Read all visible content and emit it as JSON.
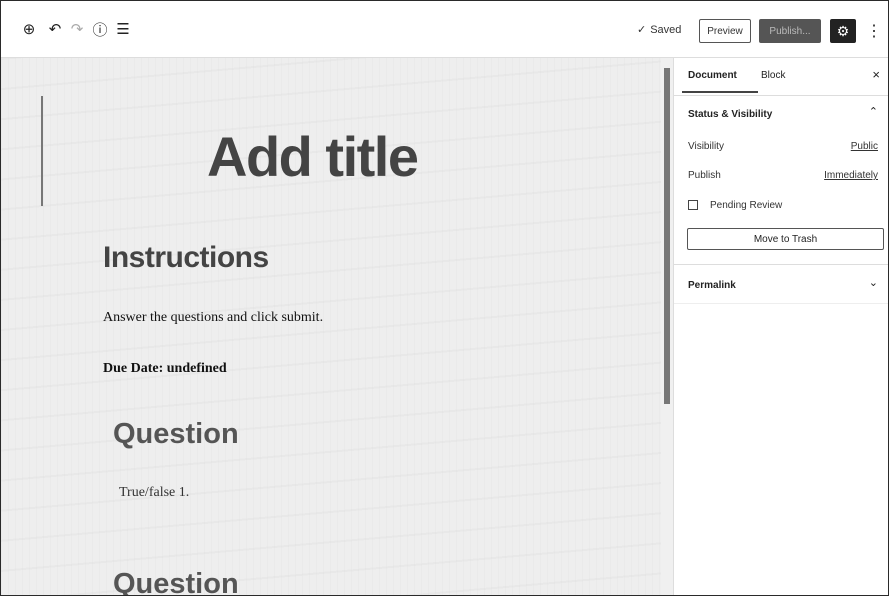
{
  "toolbar": {
    "add_icon": "⊕",
    "undo_icon": "↶",
    "redo_icon": "↷",
    "info_icon": "ⓘ",
    "outline_icon": "☰",
    "saved_check": "✓",
    "saved_label": "Saved",
    "preview_label": "Preview",
    "publish_label": "Publish...",
    "settings_icon": "⚙",
    "more_icon": "⋮"
  },
  "editor": {
    "title_placeholder": "Add title",
    "heading_instructions": "Instructions",
    "para_answer": "Answer the questions and click submit.",
    "para_due": "Due Date: undefined",
    "heading_question_1": "Question",
    "para_question_1": "True/false 1.",
    "heading_question_2": "Question"
  },
  "sidebar": {
    "tab_document": "Document",
    "tab_block": "Block",
    "close_icon": "×",
    "status_panel_title": "Status & Visibility",
    "status_chevron": "⌃",
    "visibility_label": "Visibility",
    "visibility_value": "Public",
    "publish_label": "Publish",
    "publish_value": "Immediately",
    "pending_review_label": "Pending Review",
    "pending_review_checked": false,
    "move_to_trash_label": "Move to Trash",
    "permalink_title": "Permalink",
    "permalink_chevron": "⌄"
  }
}
